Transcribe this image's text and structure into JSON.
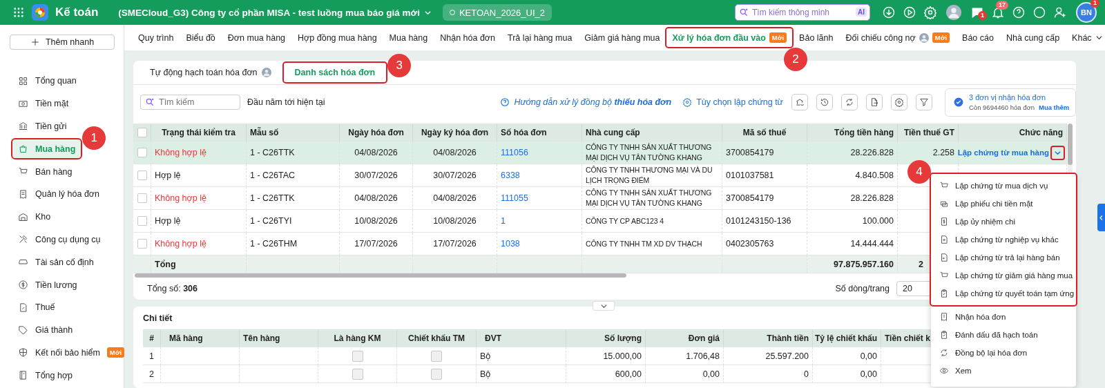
{
  "topbar": {
    "app_name": "Kế toán",
    "company": "(SMECloud_G3) Công ty cổ phần MISA - test luồng mua báo giá mới",
    "database": "KETOAN_2026_UI_2",
    "search": {
      "placeholder": "Tìm kiếm thông minh",
      "ai_badge": "AI"
    },
    "chat_badge": "1",
    "notification_badge": "17",
    "user_initials": "BN",
    "user_badge": "1"
  },
  "sidebar": {
    "quick_add": "Thêm nhanh",
    "items": [
      {
        "label": "Tổng quan",
        "selected": false,
        "highlighted": false
      },
      {
        "label": "Tiền mặt",
        "selected": false,
        "highlighted": false
      },
      {
        "label": "Tiền gửi",
        "selected": false,
        "highlighted": false
      },
      {
        "label": "Mua hàng",
        "selected": true,
        "highlighted": true,
        "callout": "1"
      },
      {
        "label": "Bán hàng",
        "selected": false,
        "highlighted": false
      },
      {
        "label": "Quản lý hóa đơn",
        "selected": false,
        "highlighted": false
      },
      {
        "label": "Kho",
        "selected": false,
        "highlighted": false
      },
      {
        "label": "Công cụ dụng cụ",
        "selected": false,
        "highlighted": false
      },
      {
        "label": "Tài sản cố định",
        "selected": false,
        "highlighted": false
      },
      {
        "label": "Tiền lương",
        "selected": false,
        "highlighted": false
      },
      {
        "label": "Thuế",
        "selected": false,
        "highlighted": false
      },
      {
        "label": "Giá thành",
        "selected": false,
        "highlighted": false
      },
      {
        "label": "Kết nối bảo hiểm",
        "selected": false,
        "highlighted": false,
        "badge": "Mới"
      },
      {
        "label": "Tổng hợp",
        "selected": false,
        "highlighted": false
      }
    ]
  },
  "nav_tabs": [
    {
      "label": "Quy trình",
      "selected": false,
      "highlighted": false
    },
    {
      "label": "Biểu đồ",
      "selected": false,
      "highlighted": false
    },
    {
      "label": "Đơn mua hàng",
      "selected": false,
      "highlighted": false
    },
    {
      "label": "Hợp đồng mua hàng",
      "selected": false,
      "highlighted": false
    },
    {
      "label": "Mua hàng",
      "selected": false,
      "highlighted": false
    },
    {
      "label": "Nhận hóa đơn",
      "selected": false,
      "highlighted": false
    },
    {
      "label": "Trả lại hàng mua",
      "selected": false,
      "highlighted": false
    },
    {
      "label": "Giảm giá hàng mua",
      "selected": false,
      "highlighted": false
    },
    {
      "label": "Xử lý hóa đơn đầu vào",
      "selected": true,
      "highlighted": true,
      "badge": "Mới",
      "callout": "2"
    },
    {
      "label": "Bảo lãnh",
      "selected": false,
      "highlighted": false
    },
    {
      "label": "Đối chiếu công nợ",
      "selected": false,
      "highlighted": false,
      "avatar": true,
      "badge": "Mới"
    },
    {
      "label": "Báo cáo",
      "selected": false,
      "highlighted": false
    },
    {
      "label": "Nhà cung cấp",
      "selected": false,
      "highlighted": false
    },
    {
      "label": "Khác",
      "selected": false,
      "highlighted": false,
      "dropdown": true
    }
  ],
  "subtabs": [
    {
      "label": "Tự động hạch toán hóa đơn",
      "selected": false,
      "highlighted": false,
      "avatar": true
    },
    {
      "label": "Danh sách hóa đơn",
      "selected": true,
      "highlighted": true,
      "callout": "3"
    }
  ],
  "toolbar": {
    "search": {
      "placeholder": "Tìm kiếm"
    },
    "period": "Đầu năm tới hiện tại",
    "guide_link": "Hướng dẫn xử lý đồng bộ **thiếu hóa đơn**",
    "options": "Tùy chọn lập chứng từ"
  },
  "invoice_quota": {
    "title": "3 đơn vị nhận hóa đơn",
    "remaining": "Còn 9694460 hóa đơn",
    "buy_more": "Mua thêm"
  },
  "invoice_table": {
    "select_all_checked": false,
    "columns": [
      "Trạng thái kiểm tra",
      "Mẫu số",
      "Ngày hóa đơn",
      "Ngày ký hóa đơn",
      "Số hóa đơn",
      "Nhà cung cấp",
      "Mã số thuế",
      "Tổng tiền hàng",
      "Tiền thuế GT",
      "Chức năng"
    ],
    "rows": [
      {
        "selected": true,
        "checked": false,
        "valid": false,
        "status": "Không hợp lệ",
        "template": "1 - C26TTK",
        "invoice_date": "04/08/2026",
        "sign_date": "04/08/2026",
        "number": "111056",
        "supplier": "CÔNG TY TNHH SẢN XUẤT THƯƠNG MẠI DỊCH VỤ TÂN TƯỜNG KHANG",
        "tax_code": "3700854179",
        "goods_total": "28.226.828",
        "vat": "2.258",
        "action": {
          "label": "Lập chứng từ mua hàng",
          "highlighted": true
        }
      },
      {
        "selected": false,
        "checked": false,
        "valid": true,
        "status": "Hợp lệ",
        "template": "1 - C26TAC",
        "invoice_date": "30/07/2026",
        "sign_date": "30/07/2026",
        "number": "6338",
        "supplier": "CÔNG TY TNHH THƯƠNG MẠI VÀ DU LỊCH TRỌNG ĐIỂM",
        "tax_code": "0101037581",
        "goods_total": "4.840.508"
      },
      {
        "selected": false,
        "checked": false,
        "valid": false,
        "status": "Không hợp lệ",
        "template": "1 - C26TTK",
        "invoice_date": "04/08/2026",
        "sign_date": "04/08/2026",
        "number": "111055",
        "supplier": "CÔNG TY TNHH SẢN XUẤT THƯƠNG MẠI DỊCH VỤ TÂN TƯỜNG KHANG",
        "tax_code": "3700854179",
        "goods_total": "28.226.828"
      },
      {
        "selected": false,
        "checked": false,
        "valid": true,
        "status": "Hợp lệ",
        "template": "1 - C26TYI",
        "invoice_date": "10/08/2026",
        "sign_date": "10/08/2026",
        "number": "1",
        "supplier": "CÔNG TY CP ABC123 4",
        "tax_code": "0101243150-136",
        "goods_total": "100.000"
      },
      {
        "selected": false,
        "checked": false,
        "valid": false,
        "status": "Không hợp lệ",
        "template": "1 - C26THM",
        "invoice_date": "17/07/2026",
        "sign_date": "17/07/2026",
        "number": "1038",
        "supplier": "CÔNG TY TNHH TM XD DV THẠCH",
        "tax_code": "0402305763",
        "goods_total": "14.444.444"
      }
    ],
    "total_label": "Tổng",
    "total_goods": "97.875.957.160",
    "total_vat": "2"
  },
  "footer": {
    "total_label": "Tổng số:",
    "total": "306",
    "page_size_label": "Số dòng/trang",
    "page_size": "20"
  },
  "action_menu": {
    "callout": "4",
    "groups": [
      {
        "highlighted": true,
        "items": [
          "Lập chứng từ mua dịch vụ",
          "Lập phiếu chi tiền mặt",
          "Lập ủy nhiệm chi",
          "Lập chứng từ nghiệp vụ khác",
          "Lập chứng từ trả lại hàng bán",
          "Lập chứng từ giảm giá hàng mua",
          "Lập chứng từ quyết toán tạm ứng"
        ]
      },
      {
        "highlighted": false,
        "items": [
          "Nhận hóa đơn",
          "Đánh dấu đã hạch toán",
          "Đồng bộ lại hóa đơn",
          "Xem"
        ]
      }
    ]
  },
  "detail": {
    "title": "Chi tiết",
    "columns": [
      "#",
      "Mã hàng",
      "Tên hàng",
      "Là hàng KM",
      "Chiết khấu TM",
      "ĐVT",
      "Số lượng",
      "Đơn giá",
      "Thành tiền",
      "Tỷ lệ chiết khấu",
      "Tiền chiết k"
    ],
    "rows": [
      {
        "index": "1",
        "promo": false,
        "cash_discount": false,
        "unit": "Bộ",
        "quantity": "15.000,00",
        "unit_price": "1.706,48",
        "amount": "25.597.200",
        "discount_rate": "0,00"
      },
      {
        "index": "2",
        "promo": false,
        "cash_discount": false,
        "unit": "Bộ",
        "quantity": "600,00",
        "unit_price": "0,00",
        "amount": "0",
        "discount_rate": "0,00"
      }
    ]
  }
}
